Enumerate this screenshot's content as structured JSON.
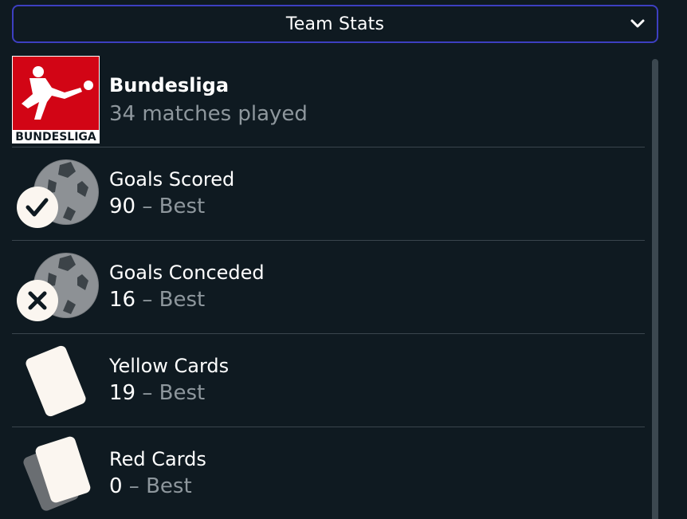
{
  "dropdown": {
    "label": "Team Stats",
    "icon": "chevron-down-icon"
  },
  "league": {
    "name": "Bundesliga",
    "subtitle": "34 matches played",
    "logo_text": "BUNDESLIGA",
    "logo_color": "#d20515"
  },
  "stats": [
    {
      "label": "Goals Scored",
      "value": "90",
      "separator": " – ",
      "rank": "Best",
      "icon": "goals-scored-icon"
    },
    {
      "label": "Goals Conceded",
      "value": "16",
      "separator": " – ",
      "rank": "Best",
      "icon": "goals-conceded-icon"
    },
    {
      "label": "Yellow Cards",
      "value": "19",
      "separator": " – ",
      "rank": "Best",
      "icon": "yellow-card-icon"
    },
    {
      "label": "Red Cards",
      "value": "0",
      "separator": " – ",
      "rank": "Best",
      "icon": "red-card-icon"
    }
  ],
  "colors": {
    "background": "#0f1a21",
    "accent_border": "#3d3fc1",
    "muted_text": "#8e979d",
    "divider": "#3a454d"
  }
}
